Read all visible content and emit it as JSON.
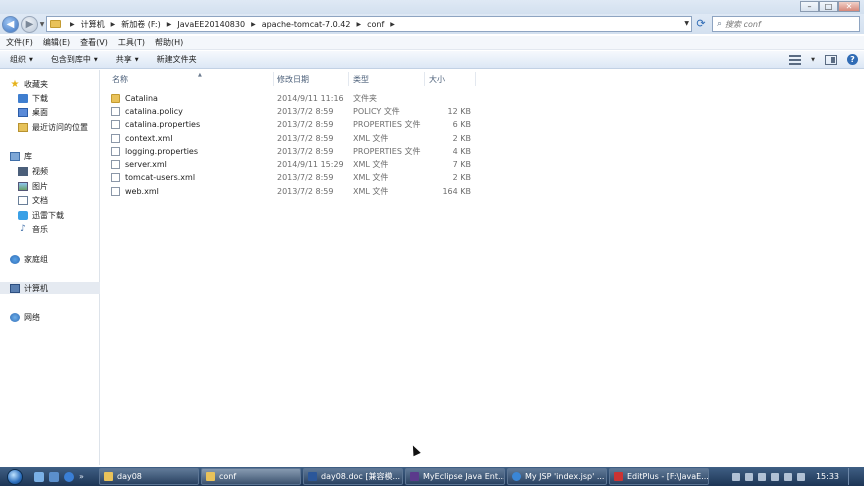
{
  "window": {
    "buttons": {
      "minimize": "–",
      "maximize": "□",
      "close": "✕"
    }
  },
  "address": {
    "crumbs": [
      "计算机",
      "新加卷 (F:)",
      "JavaEE20140830",
      "apache-tomcat-7.0.42",
      "conf"
    ],
    "search_placeholder": "搜索 conf"
  },
  "menu": [
    "文件(F)",
    "编辑(E)",
    "查看(V)",
    "工具(T)",
    "帮助(H)"
  ],
  "toolbar": {
    "organize": "组织",
    "include_library": "包含到库中",
    "share": "共享",
    "new_folder": "新建文件夹"
  },
  "sidebar": {
    "favorites": "收藏夹",
    "downloads": "下载",
    "desktop": "桌面",
    "recent": "最近访问的位置",
    "libraries": "库",
    "videos": "视频",
    "pictures": "图片",
    "documents": "文档",
    "thunder": "迅雷下载",
    "music": "音乐",
    "homegroup": "家庭组",
    "computer": "计算机",
    "network": "网络"
  },
  "columns": {
    "name": "名称",
    "date": "修改日期",
    "type": "类型",
    "size": "大小"
  },
  "files": [
    {
      "name": "Catalina",
      "date": "2014/9/11 11:16",
      "type": "文件夹",
      "size": "",
      "icon": "folder-icon"
    },
    {
      "name": "catalina.policy",
      "date": "2013/7/2 8:59",
      "type": "POLICY 文件",
      "size": "12 KB",
      "icon": "file-icon"
    },
    {
      "name": "catalina.properties",
      "date": "2013/7/2 8:59",
      "type": "PROPERTIES 文件",
      "size": "6 KB",
      "icon": "file-icon"
    },
    {
      "name": "context.xml",
      "date": "2013/7/2 8:59",
      "type": "XML 文件",
      "size": "2 KB",
      "icon": "file-icon"
    },
    {
      "name": "logging.properties",
      "date": "2013/7/2 8:59",
      "type": "PROPERTIES 文件",
      "size": "4 KB",
      "icon": "file-icon"
    },
    {
      "name": "server.xml",
      "date": "2014/9/11 15:29",
      "type": "XML 文件",
      "size": "7 KB",
      "icon": "file-icon"
    },
    {
      "name": "tomcat-users.xml",
      "date": "2013/7/2 8:59",
      "type": "XML 文件",
      "size": "2 KB",
      "icon": "file-icon"
    },
    {
      "name": "web.xml",
      "date": "2013/7/2 8:59",
      "type": "XML 文件",
      "size": "164 KB",
      "icon": "file-icon"
    }
  ],
  "taskbar": {
    "more": "»",
    "tasks": [
      {
        "label": "day08",
        "icon": "folder-icon"
      },
      {
        "label": "conf",
        "icon": "folder-icon"
      },
      {
        "label": "day08.doc [兼容模...",
        "icon": "word-icon"
      },
      {
        "label": "MyEclipse Java Ent...",
        "icon": "myeclipse-icon"
      },
      {
        "label": "My JSP 'index.jsp' ...",
        "icon": "ie-icon"
      },
      {
        "label": "EditPlus - [F:\\JavaE...",
        "icon": "editplus-icon"
      }
    ],
    "clock": "15:33"
  }
}
